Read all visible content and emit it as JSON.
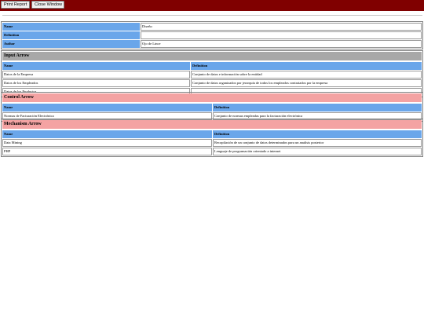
{
  "toolbar": {
    "print_label": "Print Report",
    "close_label": "Close Window"
  },
  "colors": {
    "topbar": "#800000",
    "header_cell": "#6aa6ea",
    "input_section": "#a8a8a8",
    "pink_section": "#f4a3a3"
  },
  "properties": {
    "name_label": "Name",
    "name_value": "Diseño",
    "definition_label": "Definition",
    "definition_value": "",
    "author_label": "Author",
    "author_value": "Ojo de Lince"
  },
  "input_arrow": {
    "title": "Input Arrow",
    "col_name": "Name",
    "col_definition": "Definition",
    "rows": [
      {
        "name": "Datos de la Empresa",
        "definition": "Conjunto de datos e información sobre la entidad"
      },
      {
        "name": "Datos de los Empleados",
        "definition": "Conjunto de datos organizados por jerarquía de todos los empleados contratados por la empresa"
      },
      {
        "name": "Datos de los Productos",
        "definition": ""
      }
    ]
  },
  "control_arrow": {
    "title": "Control Arrow",
    "col_name": "Name",
    "col_definition": "Definition",
    "rows": [
      {
        "name": "Normas de Facturación Electrónica",
        "definition": "Conjunto de normas empleadas para la facturación electrónica"
      }
    ]
  },
  "mechanism_arrow": {
    "title": "Mechanism Arrow",
    "col_name": "Name",
    "col_definition": "Definition",
    "rows": [
      {
        "name": "Data Mining",
        "definition": "Recopilación de un conjunto de datos determinados para un analisis posterior"
      },
      {
        "name": "PHP",
        "definition": "Lenguaje de programación orientado a internet"
      }
    ]
  }
}
